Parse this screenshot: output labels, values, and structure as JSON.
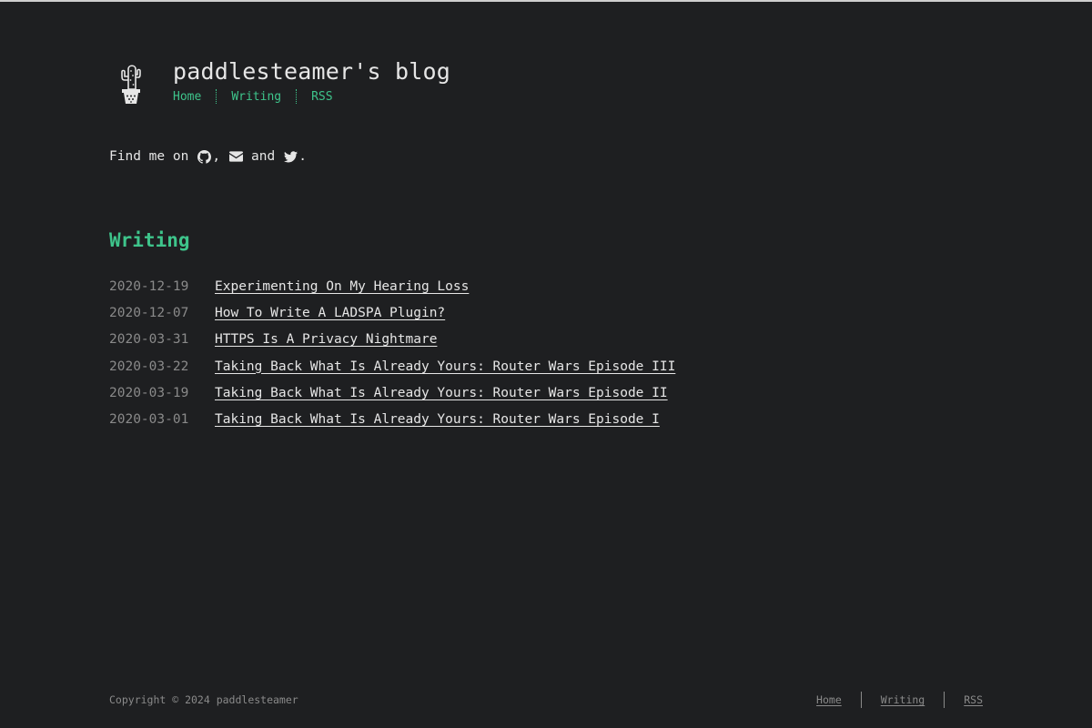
{
  "header": {
    "logo_icon": "cactus-icon",
    "site_title": "paddlesteamer's blog",
    "nav": [
      "Home",
      "Writing",
      "RSS"
    ]
  },
  "intro": {
    "prefix": "Find me on",
    "icon_github": "github-icon",
    "comma": ",",
    "icon_email": "envelope-icon",
    "and": "and",
    "icon_twitter": "twitter-icon",
    "period": "."
  },
  "writing": {
    "heading": "Writing",
    "posts": [
      {
        "date": "2020-12-19",
        "title": "Experimenting On My Hearing Loss"
      },
      {
        "date": "2020-12-07",
        "title": "How To Write A LADSPA Plugin?"
      },
      {
        "date": "2020-03-31",
        "title": "HTTPS Is A Privacy Nightmare"
      },
      {
        "date": "2020-03-22",
        "title": "Taking Back What Is Already Yours: Router Wars Episode III"
      },
      {
        "date": "2020-03-19",
        "title": "Taking Back What Is Already Yours: Router Wars Episode II"
      },
      {
        "date": "2020-03-01",
        "title": "Taking Back What Is Already Yours: Router Wars Episode I"
      }
    ]
  },
  "footer": {
    "copyright": "Copyright © 2024 paddlesteamer",
    "nav": [
      "Home",
      "Writing",
      "RSS"
    ]
  },
  "colors": {
    "background": "#1e1f21",
    "accent": "#3ec48b",
    "text": "#e6e6e6",
    "muted": "#8a8a8a"
  }
}
